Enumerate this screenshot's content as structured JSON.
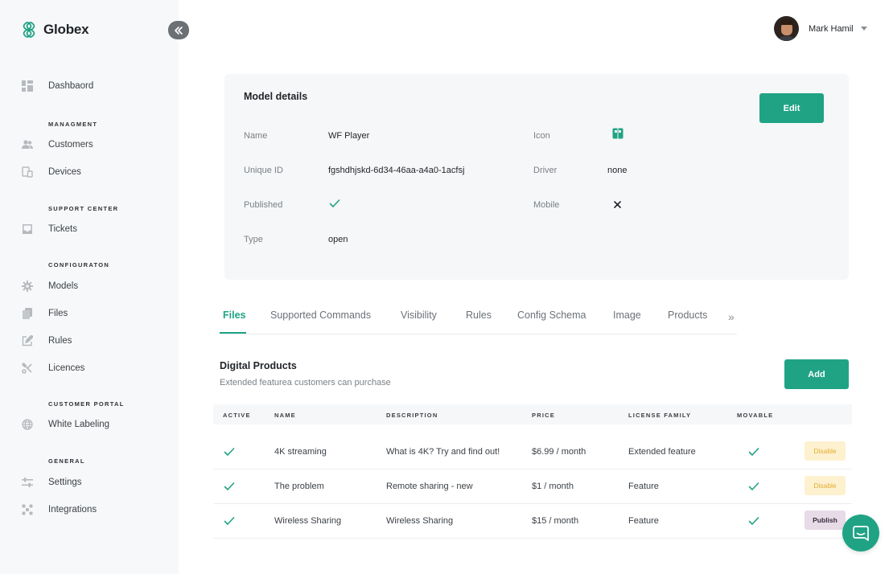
{
  "brand": {
    "name": "Globex",
    "accent": "#20a385"
  },
  "sidebar": {
    "items": [
      {
        "label": "Dashbaord",
        "icon": "dashboard-icon"
      },
      {
        "label": "Customers",
        "icon": "users-icon"
      },
      {
        "label": "Devices",
        "icon": "devices-icon"
      },
      {
        "label": "Tickets",
        "icon": "inbox-icon"
      },
      {
        "label": "Models",
        "icon": "gear-icon"
      },
      {
        "label": "Files",
        "icon": "files-icon"
      },
      {
        "label": "Rules",
        "icon": "edit-icon"
      },
      {
        "label": "Licences",
        "icon": "tools-icon"
      },
      {
        "label": "White Labeling",
        "icon": "globe-icon"
      },
      {
        "label": "Settings",
        "icon": "sliders-icon"
      },
      {
        "label": "Integrations",
        "icon": "integrations-icon"
      }
    ],
    "sections": [
      "MANAGMENT",
      "SUPPORT CENTER",
      "CONFIGURATON",
      "CUSTOMER PORTAL",
      "GENERAL"
    ]
  },
  "header": {
    "user_name": "Mark Hamil"
  },
  "model": {
    "title": "Model details",
    "edit_label": "Edit",
    "fields": {
      "name_label": "Name",
      "name_value": "WF Player",
      "uid_label": "Unique ID",
      "uid_value": "fgshdhjskd-6d34-46aa-a4a0-1acfsj",
      "published_label": "Published",
      "published_value": true,
      "type_label": "Type",
      "type_value": "open",
      "icon_label": "Icon",
      "icon_value": "board-icon",
      "driver_label": "Driver",
      "driver_value": "none",
      "mobile_label": "Mobile",
      "mobile_value": false
    }
  },
  "tabs": [
    "Files",
    "Supported Commands",
    "Visibility",
    "Rules",
    "Config Schema",
    "Image",
    "Products"
  ],
  "active_tab": "Files",
  "products": {
    "title": "Digital Products",
    "subtitle": "Extended featurea customers can purchase",
    "add_label": "Add",
    "columns": [
      "ACTIVE",
      "NAME",
      "DESCRIPTION",
      "PRICE",
      "LICENSE FAMILY",
      "MOVABLE"
    ],
    "rows": [
      {
        "active": true,
        "name": "4K streaming",
        "description": "What is 4K? Try and find out!",
        "price": "$6.99 / month",
        "family": "Extended feature",
        "movable": true,
        "action": "Disable"
      },
      {
        "active": true,
        "name": "The problem",
        "description": "Remote sharing - new",
        "price": "$1 / month",
        "family": "Feature",
        "movable": true,
        "action": "Disable"
      },
      {
        "active": true,
        "name": "Wireless Sharing",
        "description": "Wireless Sharing",
        "price": "$15 / month",
        "family": "Feature",
        "movable": true,
        "action": "Publish"
      }
    ]
  }
}
